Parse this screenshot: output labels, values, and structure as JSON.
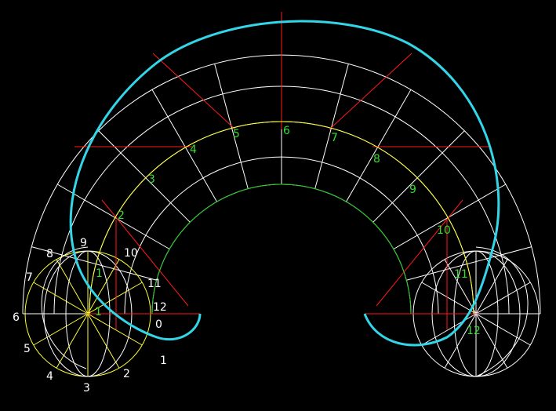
{
  "colors": {
    "background": "#000000",
    "grid": "#ffffff",
    "construction_red": "#ff1a1a",
    "yellow": "#ffff33",
    "green": "#22c822",
    "label_green": "#33dd33",
    "label_white": "#ffffff",
    "helix": "#33d6e8"
  },
  "labels": {
    "arch_numbers": [
      "2",
      "3",
      "4",
      "5",
      "6",
      "7",
      "8",
      "9",
      "10",
      "11",
      "12"
    ],
    "left_circle_white": [
      "0",
      "1",
      "2",
      "3",
      "4",
      "5",
      "6",
      "7",
      "8",
      "9",
      "10",
      "11",
      "12"
    ],
    "left_circle_green": [
      "1",
      "1"
    ]
  }
}
